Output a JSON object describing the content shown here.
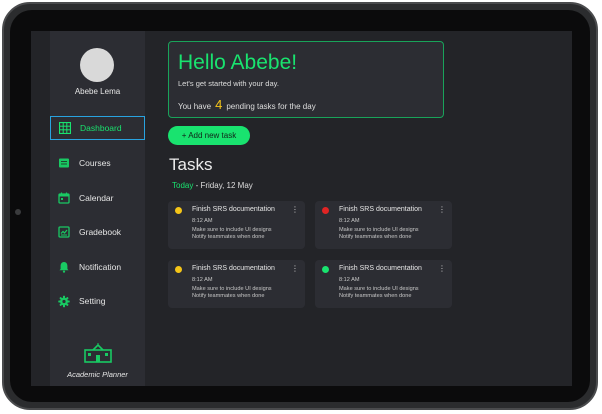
{
  "user": {
    "name": "Abebe Lema"
  },
  "sidebar": {
    "items": [
      {
        "label": "Dashboard",
        "icon": "grid-icon"
      },
      {
        "label": "Courses",
        "icon": "book-icon"
      },
      {
        "label": "Calendar",
        "icon": "calendar-icon"
      },
      {
        "label": "Gradebook",
        "icon": "gradebook-icon"
      },
      {
        "label": "Notification",
        "icon": "bell-icon"
      },
      {
        "label": "Setting",
        "icon": "gear-icon"
      }
    ],
    "logo_text": "Academic Planner"
  },
  "hero": {
    "greeting": "Hello Abebe!",
    "subtitle": "Let's get started with your day.",
    "pending_prefix": "You have",
    "pending_count": "4",
    "pending_suffix": "pending tasks for the day"
  },
  "actions": {
    "add_task": "+ Add new task"
  },
  "tasks": {
    "heading": "Tasks",
    "date_label": "Today",
    "date_rest": "- Friday, 12 May",
    "items": [
      {
        "title": "Finish SRS documentation",
        "time": "8:12 AM",
        "note1": "Make sure to include UI designs",
        "note2": "Notify teammates when done",
        "status_color": "#f5c518",
        "menu": "⋮"
      },
      {
        "title": "Finish SRS documentation",
        "time": "8:12 AM",
        "note1": "Make sure to include UI designs",
        "note2": "Notify teammates when done",
        "status_color": "#e02424",
        "menu": "⋮"
      },
      {
        "title": "Finish SRS documentation",
        "time": "8:12 AM",
        "note1": "Make sure to include UI designs",
        "note2": "Notify teammates when done",
        "status_color": "#f5c518",
        "menu": "⋮"
      },
      {
        "title": "Finish SRS documentation",
        "time": "8:12 AM",
        "note1": "Make sure to include UI designs",
        "note2": "Notify teammates when done",
        "status_color": "#19e36f",
        "menu": "⋮"
      }
    ]
  },
  "colors": {
    "accent": "#19e36f",
    "background": "#232428",
    "panel": "#2c2d33",
    "highlight": "#f5c518",
    "active_border": "#29a3e0"
  }
}
